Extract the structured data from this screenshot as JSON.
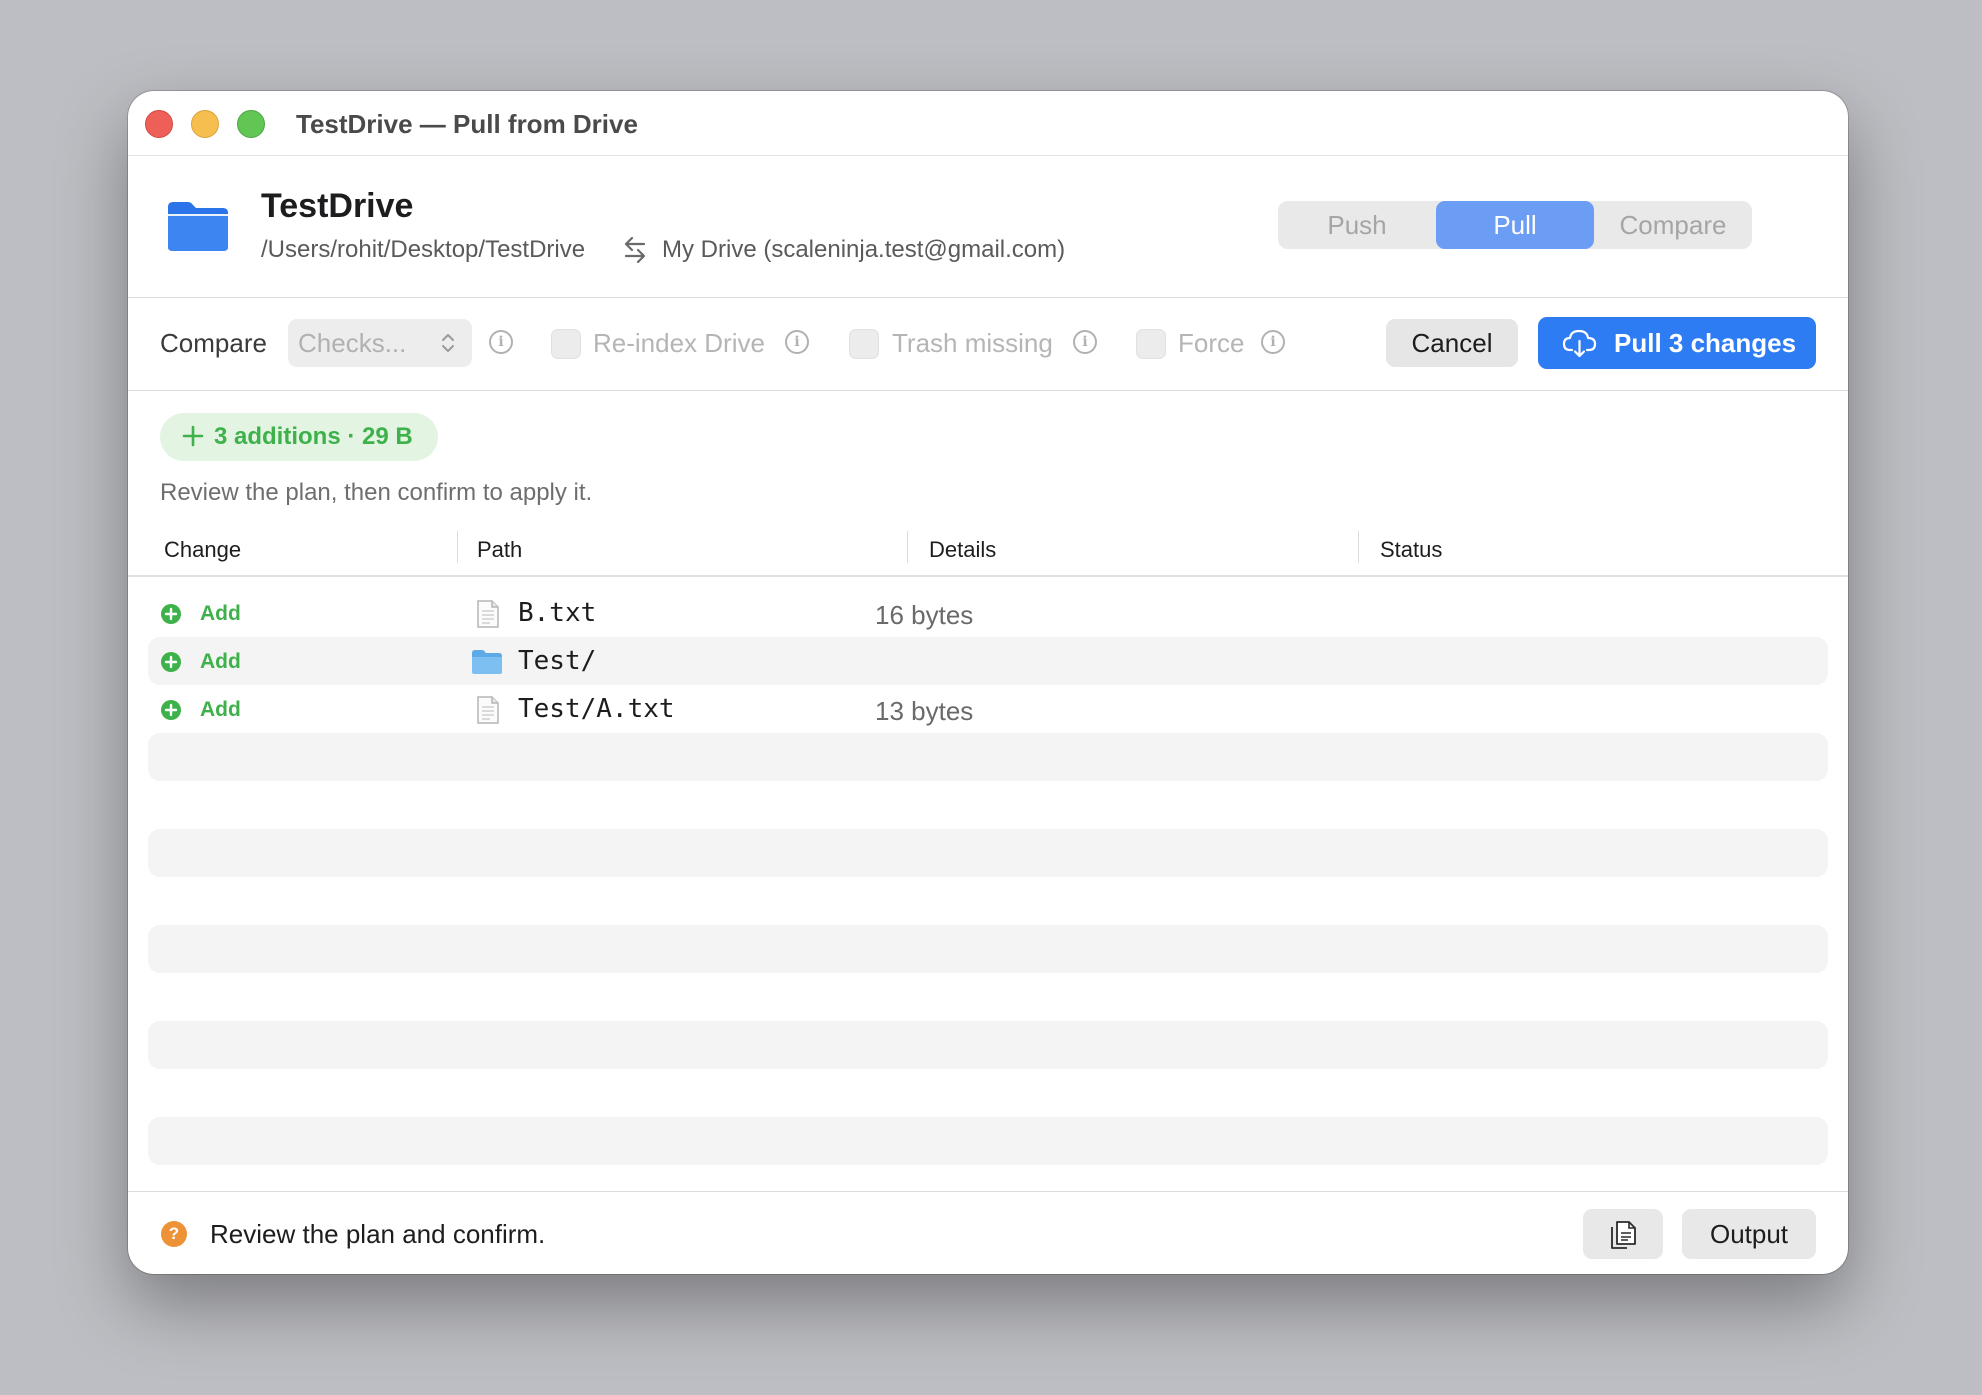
{
  "window": {
    "title": "TestDrive — Pull from Drive"
  },
  "header": {
    "project_name": "TestDrive",
    "local_path": "/Users/rohit/Desktop/TestDrive",
    "remote": "My Drive (scaleninja.test@gmail.com)",
    "modes": [
      {
        "label": "Push",
        "active": false
      },
      {
        "label": "Pull",
        "active": true
      },
      {
        "label": "Compare",
        "active": false
      }
    ]
  },
  "toolbar": {
    "compare_label": "Compare",
    "compare_value": "Checks...",
    "reindex_label": "Re-index Drive",
    "trash_label": "Trash missing",
    "force_label": "Force",
    "cancel_label": "Cancel",
    "primary_label": "Pull 3 changes",
    "info_glyph": "i"
  },
  "summary": {
    "badge": "3 additions · 29 B",
    "hint": "Review the plan, then confirm to apply it."
  },
  "table": {
    "headers": [
      "Change",
      "Path",
      "Details",
      "Status"
    ],
    "rows": [
      {
        "change": "Add",
        "path": "B.txt",
        "type": "file",
        "details": "16 bytes",
        "status": ""
      },
      {
        "change": "Add",
        "path": "Test/",
        "type": "folder",
        "details": "",
        "status": ""
      },
      {
        "change": "Add",
        "path": "Test/A.txt",
        "type": "file",
        "details": "13 bytes",
        "status": ""
      }
    ]
  },
  "footer": {
    "status_glyph": "?",
    "status_text": "Review the plan and confirm.",
    "output_label": "Output"
  },
  "colors": {
    "accent": "#2d7cf3",
    "segment_active": "#6b9df4",
    "addition_green": "#3eb24a",
    "badge_bg": "#e3f4e3",
    "warning_orange": "#ee9237"
  },
  "icons": {
    "folder": "folder-icon",
    "swap": "swap-arrows-icon",
    "cloud": "cloud-download-icon",
    "add": "plus-circle-icon",
    "file": "document-icon",
    "copy": "copy-icon",
    "status": "question-circle-icon"
  }
}
